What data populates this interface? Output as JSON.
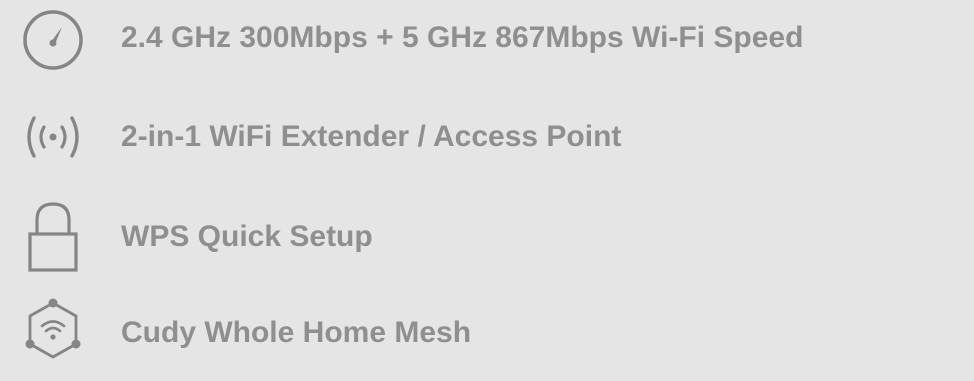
{
  "features": [
    {
      "label": "2.4 GHz 300Mbps + 5 GHz 867Mbps Wi-Fi Speed",
      "icon": "speedometer-icon"
    },
    {
      "label": "2-in-1 WiFi Extender / Access Point",
      "icon": "wireless-signal-icon"
    },
    {
      "label": "WPS Quick Setup",
      "icon": "lock-icon"
    },
    {
      "label": "Cudy Whole Home Mesh",
      "icon": "mesh-wifi-icon"
    }
  ],
  "colors": {
    "background": "#e5e5e5",
    "text": "#8f8f8f",
    "icon": "#858585"
  }
}
